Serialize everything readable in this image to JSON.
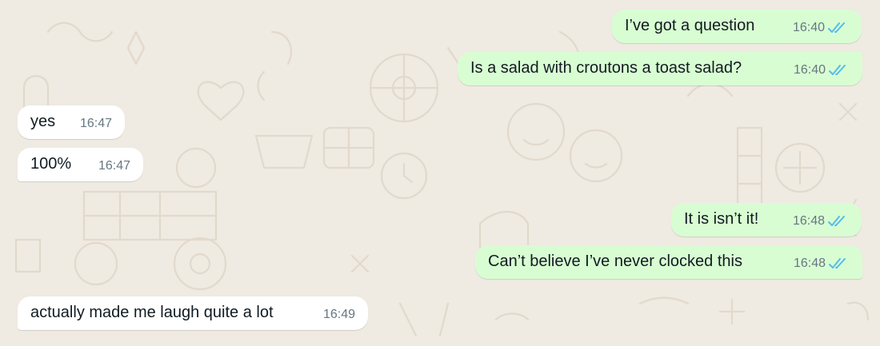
{
  "colors": {
    "outgoing_bubble": "#d9fdd3",
    "incoming_bubble": "#ffffff",
    "wallpaper": "#efeae2",
    "read_ticks": "#53bdeb",
    "meta_text": "#667781"
  },
  "messages": [
    {
      "direction": "outgoing",
      "text": "I’ve got a question",
      "time": "16:40",
      "status": "read"
    },
    {
      "direction": "outgoing",
      "text": "Is a salad with croutons a toast salad?",
      "time": "16:40",
      "status": "read"
    },
    {
      "direction": "incoming",
      "text": "yes",
      "time": "16:47"
    },
    {
      "direction": "incoming",
      "text": "100%",
      "time": "16:47"
    },
    {
      "direction": "outgoing",
      "text": "It is isn’t it!",
      "time": "16:48",
      "status": "read"
    },
    {
      "direction": "outgoing",
      "text": "Can’t believe I’ve never clocked this",
      "time": "16:48",
      "status": "read"
    },
    {
      "direction": "incoming",
      "text": "actually made me laugh quite a lot",
      "time": "16:49"
    }
  ]
}
